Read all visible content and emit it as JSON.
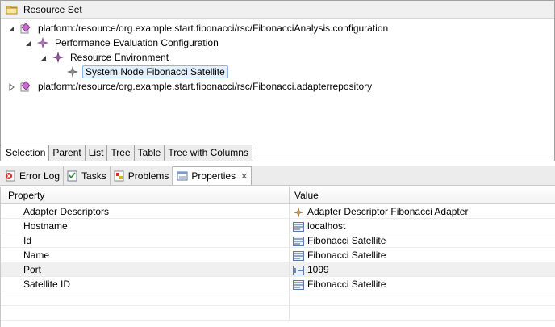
{
  "editor": {
    "title": "Resource Set",
    "tree": [
      {
        "label": "platform:/resource/org.example.start.fibonacci/rsc/FibonacciAnalysis.configuration",
        "level": 0,
        "expanded": true,
        "icon": "config-model-icon"
      },
      {
        "label": "Performance Evaluation Configuration",
        "level": 1,
        "expanded": true,
        "icon": "star-node-icon"
      },
      {
        "label": "Resource Environment",
        "level": 2,
        "expanded": true,
        "icon": "star-node-icon"
      },
      {
        "label": "System Node Fibonacci Satellite",
        "level": 3,
        "selected": true,
        "icon": "star-node-icon"
      },
      {
        "label": "platform:/resource/org.example.start.fibonacci/rsc/Fibonacci.adapterrepository",
        "level": 0,
        "expanded": false,
        "icon": "config-model-icon"
      }
    ],
    "tabs": [
      "Selection",
      "Parent",
      "List",
      "Tree",
      "Table",
      "Tree with Columns"
    ],
    "active_tab": "Selection"
  },
  "views": {
    "tabs": [
      {
        "label": "Error Log",
        "icon": "error-log-icon"
      },
      {
        "label": "Tasks",
        "icon": "tasks-icon"
      },
      {
        "label": "Problems",
        "icon": "problems-icon"
      },
      {
        "label": "Properties",
        "icon": "properties-icon",
        "active": true
      }
    ]
  },
  "properties": {
    "headers": {
      "property": "Property",
      "value": "Value"
    },
    "rows": [
      {
        "property": "Adapter Descriptors",
        "value": "Adapter Descriptor Fibonacci Adapter",
        "icon": "star-node-icon"
      },
      {
        "property": "Hostname",
        "value": "localhost",
        "icon": "text-value-icon"
      },
      {
        "property": "Id",
        "value": "Fibonacci Satellite",
        "icon": "text-value-icon"
      },
      {
        "property": "Name",
        "value": "Fibonacci Satellite",
        "icon": "text-value-icon"
      },
      {
        "property": "Port",
        "value": "1099",
        "icon": "number-value-icon",
        "selected": true
      },
      {
        "property": "Satellite ID",
        "value": "Fibonacci Satellite",
        "icon": "text-value-icon"
      }
    ]
  },
  "colors": {
    "selection_bg": "#e6f0fa",
    "selection_border": "#8db5e0",
    "chrome": "#ececec"
  }
}
